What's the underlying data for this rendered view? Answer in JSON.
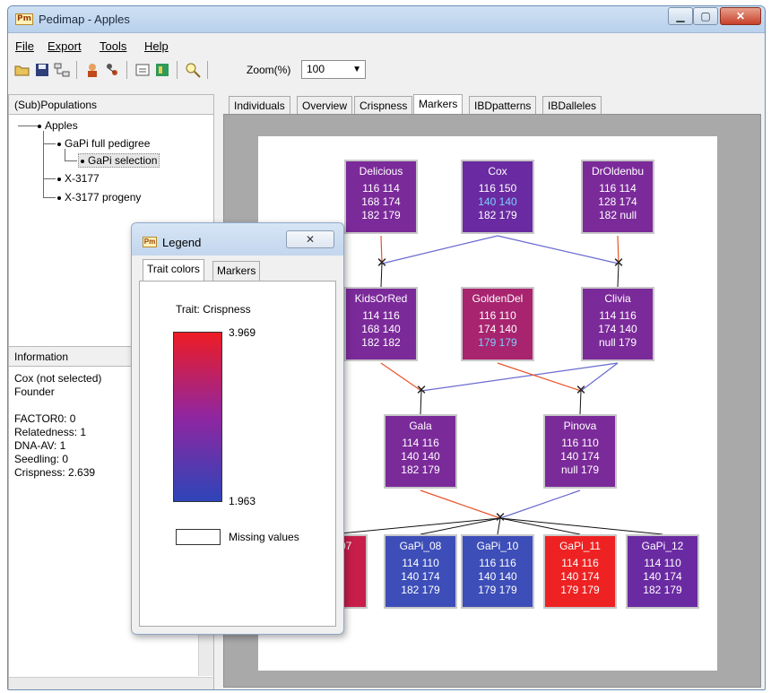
{
  "window": {
    "title": "Pedimap - Apples",
    "logo_text": "Pm"
  },
  "menu": [
    "File",
    "Export",
    "Tools",
    "Help"
  ],
  "toolbar": {
    "zoom_label": "Zoom(%)",
    "zoom_value": "100"
  },
  "left_pane": {
    "populations_header": "(Sub)Populations",
    "tree": [
      "Apples",
      "GaPi full pedigree",
      "GaPi selection",
      "X-3177",
      "X-3177 progeny"
    ],
    "information_header": "Information",
    "info": [
      "Cox (not selected)",
      "Founder",
      "",
      "FACTOR0: 0",
      "Relatedness: 1",
      "DNA-AV: 1",
      "Seedling: 0",
      "Crispness: 2.639"
    ]
  },
  "tabs": [
    "Individuals",
    "Overview",
    "Crispness",
    "Markers",
    "IBDpatterns",
    "IBDalleles"
  ],
  "active_tab": "Markers",
  "pedigree": {
    "nodes": [
      {
        "name": "Delicious",
        "rows": [
          "116 114",
          "168 174",
          "182 179"
        ],
        "color": "#7b2a9a"
      },
      {
        "name": "Cox",
        "rows": [
          "116 150",
          "140 140",
          "182 179"
        ],
        "color": "#6a2aa2",
        "highlight_row": 1
      },
      {
        "name": "DrOldenbu",
        "rows": [
          "116 114",
          "128 174",
          "182 null"
        ],
        "color": "#7b2a9a"
      },
      {
        "name": "KidsOrRed",
        "rows": [
          "114 116",
          "168 140",
          "182 182"
        ],
        "color": "#7b2a9a"
      },
      {
        "name": "GoldenDel",
        "rows": [
          "116 110",
          "174 140",
          "179 179"
        ],
        "color": "#a8246f",
        "highlight_row": 2
      },
      {
        "name": "Clivia",
        "rows": [
          "114 116",
          "174 140",
          "null 179"
        ],
        "color": "#7b2a9a"
      },
      {
        "name": "Gala",
        "rows": [
          "114 116",
          "140 140",
          "182 179"
        ],
        "color": "#7b2a9a"
      },
      {
        "name": "Pinova",
        "rows": [
          "116 110",
          "140 174",
          "null 179"
        ],
        "color": "#7b2a9a"
      },
      {
        "name": "GaPi_07",
        "rows": [
          "",
          "",
          "179"
        ],
        "color": "#c81e4a"
      },
      {
        "name": "GaPi_08",
        "rows": [
          "114 110",
          "140 174",
          "182 179"
        ],
        "color": "#3d4eb8"
      },
      {
        "name": "GaPi_10",
        "rows": [
          "116 116",
          "140 140",
          "179 179"
        ],
        "color": "#3d4eb8"
      },
      {
        "name": "GaPi_11",
        "rows": [
          "114 116",
          "140 174",
          "179 179"
        ],
        "color": "#ee2222"
      },
      {
        "name": "GaPi_12",
        "rows": [
          "114 110",
          "140 174",
          "182 179"
        ],
        "color": "#6a2aa2"
      }
    ],
    "mating_symbol": "✕",
    "line_colors": {
      "female": "#e8552a",
      "male": "#6a6ad0",
      "progeny": "#111111"
    }
  },
  "legend": {
    "title": "Legend",
    "tabs": [
      "Trait colors",
      "Markers"
    ],
    "trait_label": "Trait: Crispness",
    "max": "3.969",
    "min": "1.963",
    "missing_label": "Missing values",
    "gradient_colors": [
      "#ee1c24",
      "#9026a0",
      "#2d45b8"
    ]
  },
  "colors": {
    "highlight_text": "#7ecfff"
  }
}
